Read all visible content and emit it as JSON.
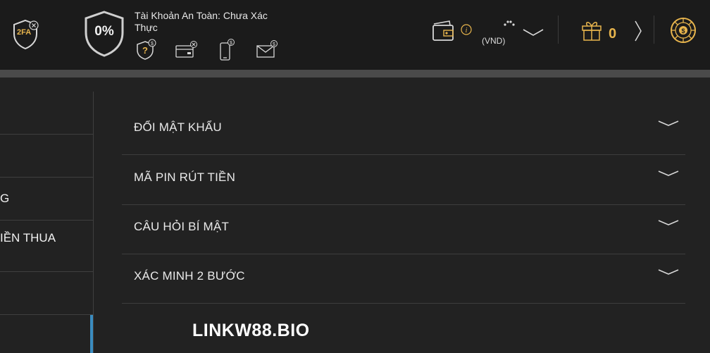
{
  "header": {
    "twofa_badge": "2FA",
    "security_percent": "0%",
    "security_title": "Tài Khoản An Toàn: Chưa Xác Thực",
    "currency": "(VND)",
    "gift_count": "0"
  },
  "sidebar": {
    "items": [
      {
        "label": ""
      },
      {
        "label": ""
      },
      {
        "label": "G"
      },
      {
        "label": "IỀN THUA"
      },
      {
        "label": ""
      },
      {
        "label": ""
      }
    ]
  },
  "accordion": {
    "items": [
      {
        "label": "ĐỔI MẬT KHẨU"
      },
      {
        "label": "MÃ PIN RÚT TIỀN"
      },
      {
        "label": "CÂU HỎI BÍ MẬT"
      },
      {
        "label": "XÁC MINH 2 BƯỚC"
      }
    ]
  },
  "watermark": "LINKW88.BIO",
  "colors": {
    "accent_gold": "#e8b54d",
    "active_blue": "#3a8cc0",
    "background": "#222222"
  },
  "icons": [
    "2fa-shield-icon",
    "percent-shield-icon",
    "question-shield-icon",
    "card-icon",
    "phone-icon",
    "email-icon",
    "wallet-icon",
    "info-icon",
    "loading-icon",
    "chevron-down-icon",
    "gift-icon",
    "chevron-right-icon",
    "lucky-wheel-icon"
  ]
}
